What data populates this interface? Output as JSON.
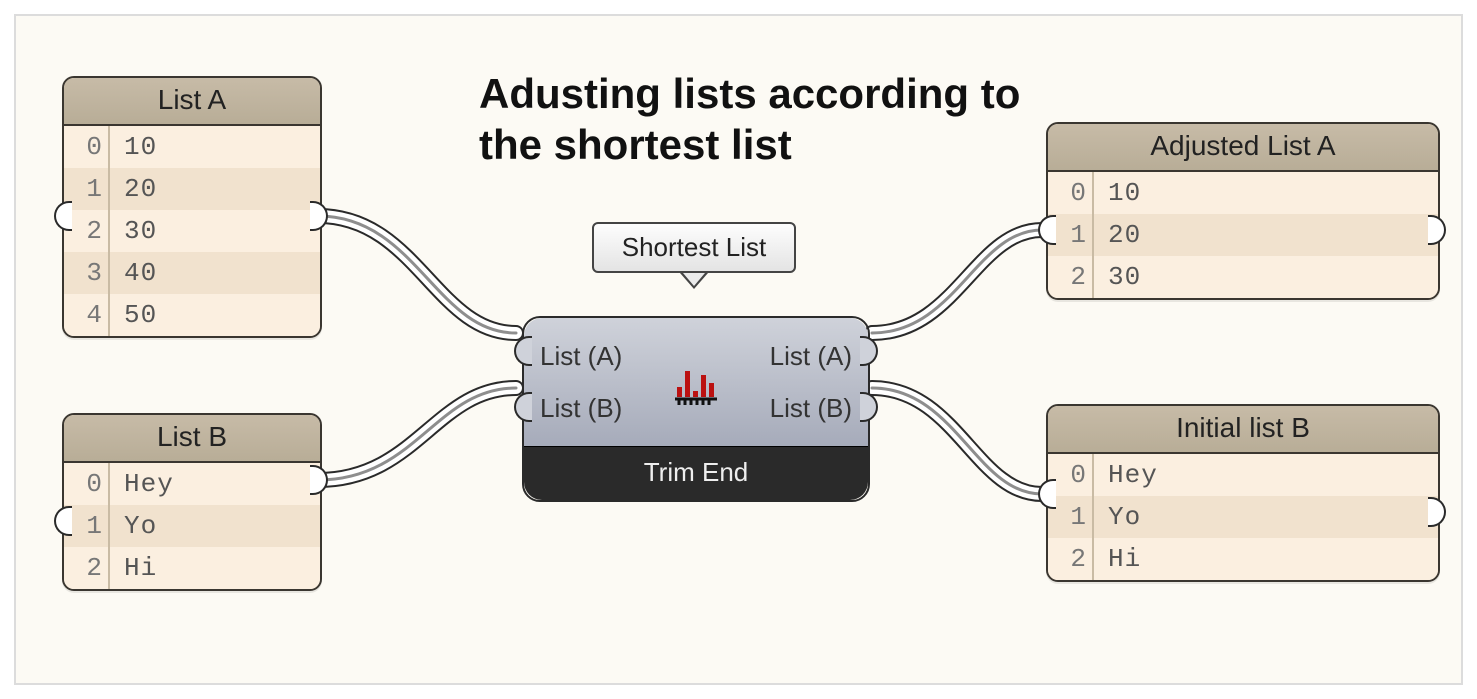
{
  "title": "Adusting lists according to the shortest list",
  "tooltip": "Shortest List",
  "component": {
    "inputA": "List (A)",
    "inputB": "List (B)",
    "outputA": "List (A)",
    "outputB": "List (B)",
    "footer": "Trim End"
  },
  "panels": {
    "listA": {
      "title": "List A",
      "rows": [
        {
          "i": "0",
          "v": "10"
        },
        {
          "i": "1",
          "v": "20"
        },
        {
          "i": "2",
          "v": "30"
        },
        {
          "i": "3",
          "v": "40"
        },
        {
          "i": "4",
          "v": "50"
        }
      ]
    },
    "listB": {
      "title": "List B",
      "rows": [
        {
          "i": "0",
          "v": "Hey"
        },
        {
          "i": "1",
          "v": "Yo"
        },
        {
          "i": "2",
          "v": "Hi"
        }
      ]
    },
    "adjustedA": {
      "title": "Adjusted List A",
      "rows": [
        {
          "i": "0",
          "v": "10"
        },
        {
          "i": "1",
          "v": "20"
        },
        {
          "i": "2",
          "v": "30"
        }
      ]
    },
    "initialB": {
      "title": "Initial list B",
      "rows": [
        {
          "i": "0",
          "v": "Hey"
        },
        {
          "i": "1",
          "v": "Yo"
        },
        {
          "i": "2",
          "v": "Hi"
        }
      ]
    }
  }
}
